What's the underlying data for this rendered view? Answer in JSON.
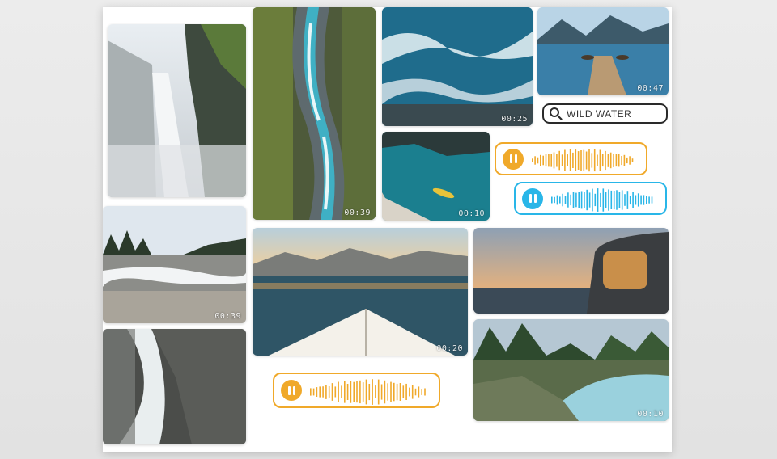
{
  "search": {
    "label": "WILD WATER",
    "icon": "search-icon"
  },
  "tiles": {
    "waterfall_top": {
      "duration": ""
    },
    "river_aerial": {
      "duration": "00:39"
    },
    "ocean_waves": {
      "duration": "00:25"
    },
    "lake_dock": {
      "duration": "00:47"
    },
    "kayak_cove": {
      "duration": "00:10"
    },
    "river_rapids_forest": {
      "duration": "00:39"
    },
    "kayak_bow_lake": {
      "duration": "00:20"
    },
    "van_sunset": {
      "duration": ""
    },
    "forest_river": {
      "duration": "00:10"
    },
    "waterfall_rocks": {
      "duration": ""
    }
  },
  "players": [
    {
      "name": "audio-player-orange-1",
      "color": "#f0a92a",
      "state": "paused"
    },
    {
      "name": "audio-player-blue",
      "color": "#29b6e8",
      "state": "paused"
    },
    {
      "name": "audio-player-orange-2",
      "color": "#f0a92a",
      "state": "paused"
    }
  ]
}
